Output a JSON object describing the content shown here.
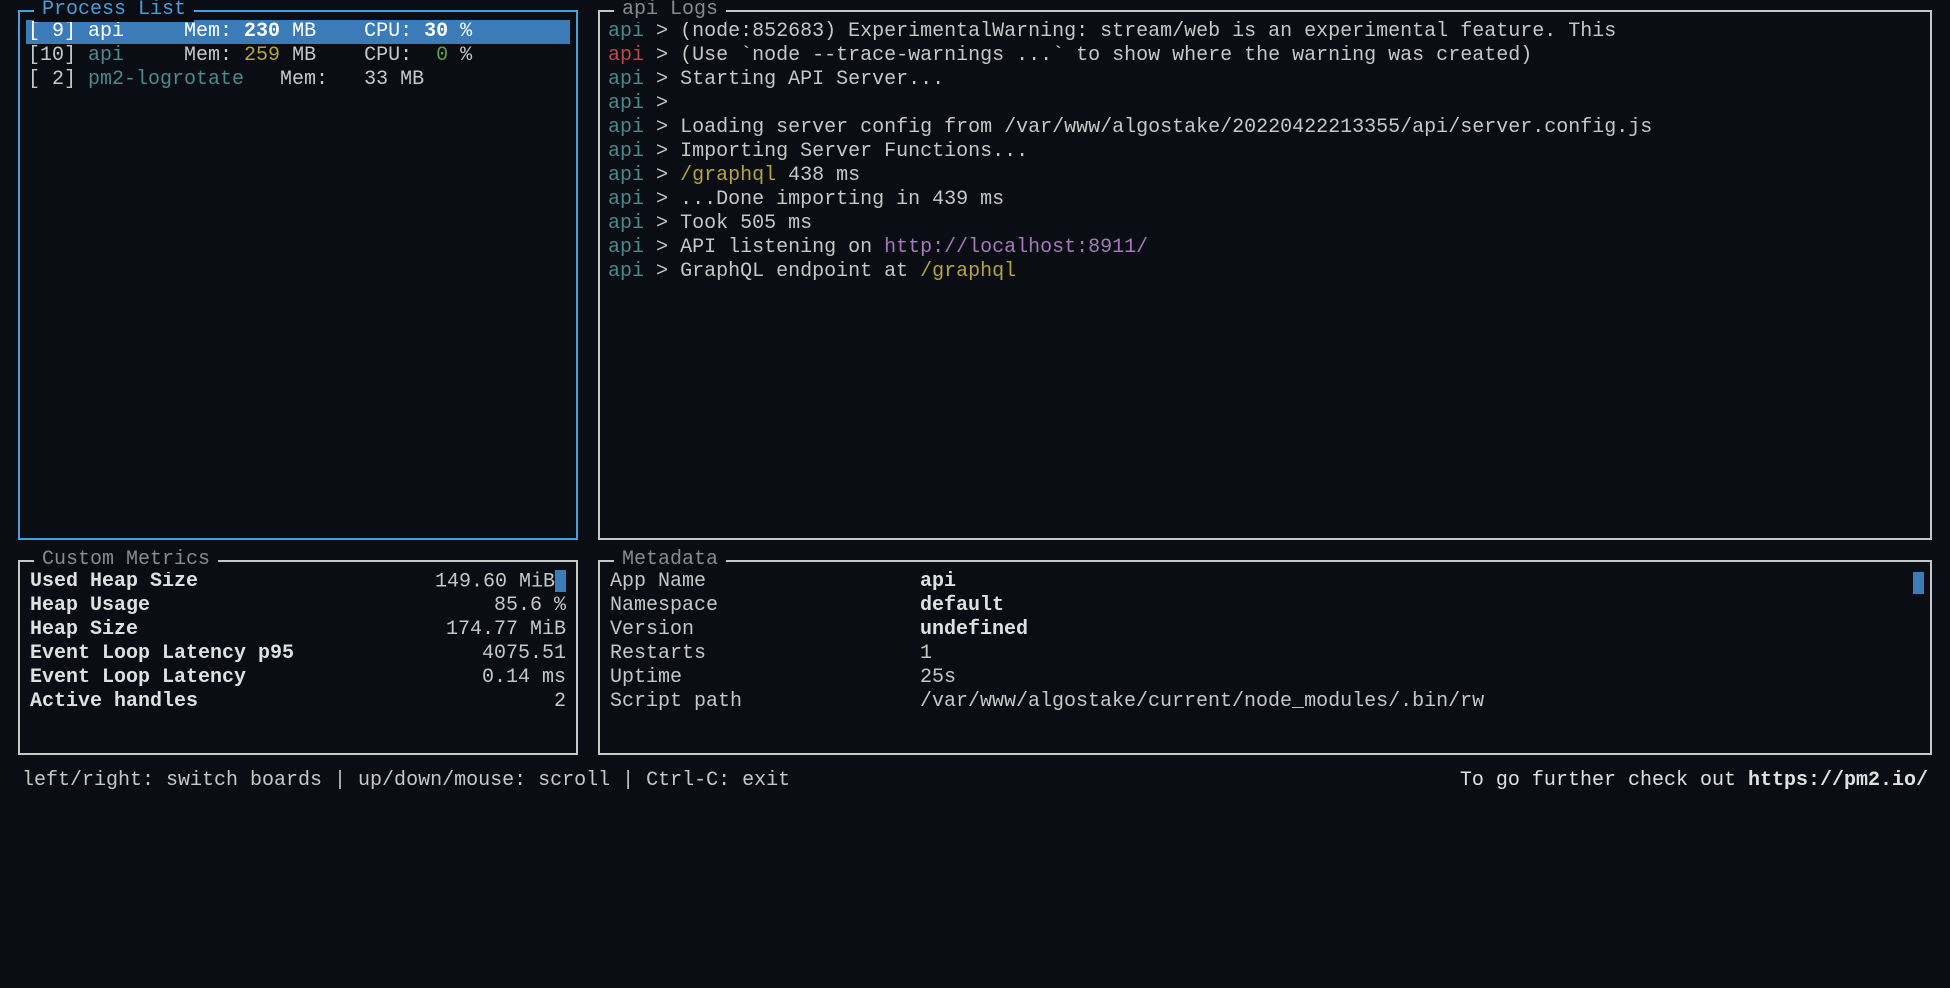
{
  "panels": {
    "process_list_title": "Process List",
    "logs_title": "api Logs",
    "metrics_title": "Custom Metrics",
    "metadata_title": "Metadata"
  },
  "processes": {
    "headers": {
      "mem": "Mem:",
      "cpu": "CPU:",
      "mb": "MB",
      "pct": "%"
    },
    "rows": [
      {
        "id": "[ 9]",
        "name": "api",
        "mem": "230",
        "cpu": "30",
        "selected": true
      },
      {
        "id": "[10]",
        "name": "api",
        "mem": "259",
        "cpu": "0",
        "selected": false
      },
      {
        "id": "[ 2]",
        "name": "pm2-logrotate",
        "mem": "33",
        "cpu": null,
        "selected": false
      }
    ]
  },
  "logs": {
    "prefix": "api",
    "sep": ">",
    "lines": [
      {
        "text": "(node:852683) ExperimentalWarning: stream/web is an experimental feature. This",
        "prefixColor": "teal"
      },
      {
        "text": "(Use `node --trace-warnings ...` to show where the warning was created)",
        "prefixColor": "red"
      },
      {
        "text": "Starting API Server...",
        "prefixColor": "teal"
      },
      {
        "text": "",
        "prefixColor": "teal"
      },
      {
        "text": "Loading server config from /var/www/algostake/20220422213355/api/server.config.js",
        "prefixColor": "teal"
      },
      {
        "text": "Importing Server Functions...",
        "prefixColor": "teal"
      },
      {
        "segments": [
          {
            "t": "/graphql",
            "c": "yellow"
          },
          {
            "t": " 438 ms",
            "c": ""
          }
        ],
        "prefixColor": "teal"
      },
      {
        "text": "...Done importing in 439 ms",
        "prefixColor": "teal"
      },
      {
        "text": "Took 505 ms",
        "prefixColor": "teal"
      },
      {
        "segments": [
          {
            "t": "API listening on ",
            "c": ""
          },
          {
            "t": "http://localhost:8911/",
            "c": "purple"
          }
        ],
        "prefixColor": "teal"
      },
      {
        "segments": [
          {
            "t": "GraphQL endpoint at ",
            "c": ""
          },
          {
            "t": "/graphql",
            "c": "yellow"
          }
        ],
        "prefixColor": "teal"
      }
    ]
  },
  "metrics": [
    {
      "label": "Used Heap Size",
      "value": "149.60 MiB",
      "selected": true
    },
    {
      "label": "Heap Usage",
      "value": "85.6 %",
      "selected": false
    },
    {
      "label": "Heap Size",
      "value": "174.77 MiB",
      "selected": false
    },
    {
      "label": "Event Loop Latency p95",
      "value": "4075.51",
      "selected": false
    },
    {
      "label": "Event Loop Latency",
      "value": "0.14 ms",
      "selected": false
    },
    {
      "label": "Active handles",
      "value": "2",
      "selected": false
    }
  ],
  "metadata": [
    {
      "label": "App Name",
      "value": "api",
      "bold": true
    },
    {
      "label": "Namespace",
      "value": "default",
      "bold": true
    },
    {
      "label": "Version",
      "value": "undefined",
      "bold": true
    },
    {
      "label": "Restarts",
      "value": "1",
      "bold": false
    },
    {
      "label": "Uptime",
      "value": "25s",
      "bold": false
    },
    {
      "label": "Script path",
      "value": "/var/www/algostake/current/node_modules/.bin/rw",
      "bold": false
    }
  ],
  "footer": {
    "left": "left/right: switch boards | up/down/mouse: scroll | Ctrl-C: exit",
    "right_prefix": "To go further check out ",
    "right_link": "https://pm2.io/"
  }
}
